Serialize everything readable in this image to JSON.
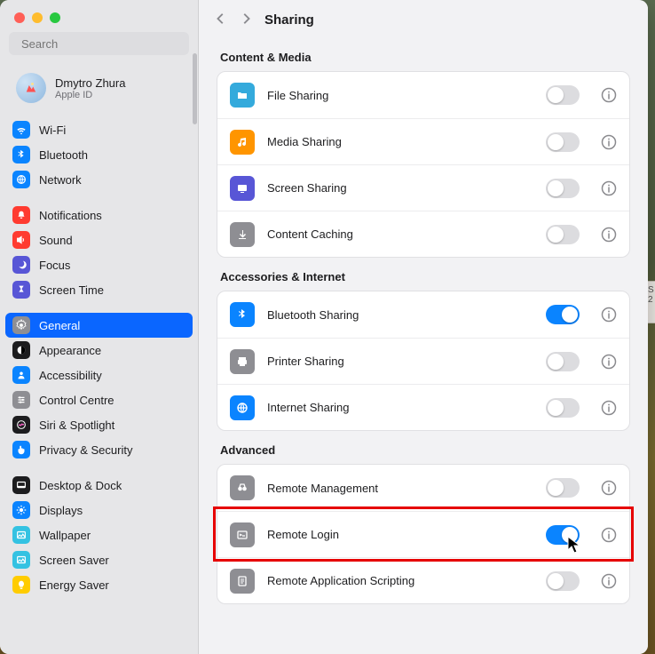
{
  "traffic_lights": [
    "close",
    "minimize",
    "maximize"
  ],
  "search": {
    "placeholder": "Search"
  },
  "account": {
    "name": "Dmytro Zhura",
    "sub": "Apple ID"
  },
  "sidebar": {
    "groups": [
      {
        "items": [
          {
            "id": "wifi",
            "label": "Wi-Fi",
            "iconBg": "#0a84ff"
          },
          {
            "id": "bluetooth",
            "label": "Bluetooth",
            "iconBg": "#0a84ff"
          },
          {
            "id": "network",
            "label": "Network",
            "iconBg": "#0a84ff"
          }
        ]
      },
      {
        "items": [
          {
            "id": "notifications",
            "label": "Notifications",
            "iconBg": "#ff3b30"
          },
          {
            "id": "sound",
            "label": "Sound",
            "iconBg": "#ff3b30"
          },
          {
            "id": "focus",
            "label": "Focus",
            "iconBg": "#5856d6"
          },
          {
            "id": "screentime",
            "label": "Screen Time",
            "iconBg": "#5856d6"
          }
        ]
      },
      {
        "items": [
          {
            "id": "general",
            "label": "General",
            "iconBg": "#8e8e93",
            "selected": true
          },
          {
            "id": "appearance",
            "label": "Appearance",
            "iconBg": "#1c1c1e"
          },
          {
            "id": "accessibility",
            "label": "Accessibility",
            "iconBg": "#0a84ff"
          },
          {
            "id": "controlcentre",
            "label": "Control Centre",
            "iconBg": "#8e8e93"
          },
          {
            "id": "siri",
            "label": "Siri & Spotlight",
            "iconBg": "#1c1c1e"
          },
          {
            "id": "privacy",
            "label": "Privacy & Security",
            "iconBg": "#0a84ff"
          }
        ]
      },
      {
        "items": [
          {
            "id": "desktopdock",
            "label": "Desktop & Dock",
            "iconBg": "#1c1c1e"
          },
          {
            "id": "displays",
            "label": "Displays",
            "iconBg": "#0a84ff"
          },
          {
            "id": "wallpaper",
            "label": "Wallpaper",
            "iconBg": "#34c2e2"
          },
          {
            "id": "screensaver",
            "label": "Screen Saver",
            "iconBg": "#34c2e2"
          },
          {
            "id": "energysaver",
            "label": "Energy Saver",
            "iconBg": "#ffcc00"
          }
        ]
      }
    ]
  },
  "header": {
    "title": "Sharing"
  },
  "sections": [
    {
      "label": "Content & Media",
      "rows": [
        {
          "id": "filesharing",
          "label": "File Sharing",
          "iconBg": "#34aadc",
          "on": false
        },
        {
          "id": "mediasharing",
          "label": "Media Sharing",
          "iconBg": "#ff9500",
          "on": false
        },
        {
          "id": "screensharing",
          "label": "Screen Sharing",
          "iconBg": "#5856d6",
          "on": false
        },
        {
          "id": "contentcaching",
          "label": "Content Caching",
          "iconBg": "#8e8e93",
          "on": false
        }
      ]
    },
    {
      "label": "Accessories & Internet",
      "rows": [
        {
          "id": "bluetoothsharing",
          "label": "Bluetooth Sharing",
          "iconBg": "#0a84ff",
          "on": true
        },
        {
          "id": "printersharing",
          "label": "Printer Sharing",
          "iconBg": "#8e8e93",
          "on": false
        },
        {
          "id": "internetsharing",
          "label": "Internet Sharing",
          "iconBg": "#0a84ff",
          "on": false
        }
      ]
    },
    {
      "label": "Advanced",
      "rows": [
        {
          "id": "remotemanagement",
          "label": "Remote Management",
          "iconBg": "#8e8e93",
          "on": false
        },
        {
          "id": "remotelogin",
          "label": "Remote Login",
          "iconBg": "#8e8e93",
          "on": true,
          "highlighted": true
        },
        {
          "id": "remoteappscripting",
          "label": "Remote Application Scripting",
          "iconBg": "#8e8e93",
          "on": false
        }
      ]
    }
  ],
  "sideicons": {
    "wifi": "wifi",
    "bluetooth": "bt",
    "network": "globe",
    "notifications": "bell",
    "sound": "speaker",
    "focus": "moon",
    "screentime": "hourglass",
    "general": "gear",
    "appearance": "contrast",
    "accessibility": "person",
    "controlcentre": "sliders",
    "siri": "siri",
    "privacy": "hand",
    "desktopdock": "dock",
    "displays": "sun",
    "wallpaper": "photo",
    "screensaver": "photo",
    "energysaver": "bulb"
  },
  "mainicons": {
    "filesharing": "folder",
    "mediasharing": "music",
    "screensharing": "screen",
    "contentcaching": "download",
    "bluetoothsharing": "bt",
    "printersharing": "printer",
    "internetsharing": "globe",
    "remotemanagement": "binoc",
    "remotelogin": "terminal",
    "remoteappscripting": "script"
  },
  "desk_side_label": "S\n2"
}
